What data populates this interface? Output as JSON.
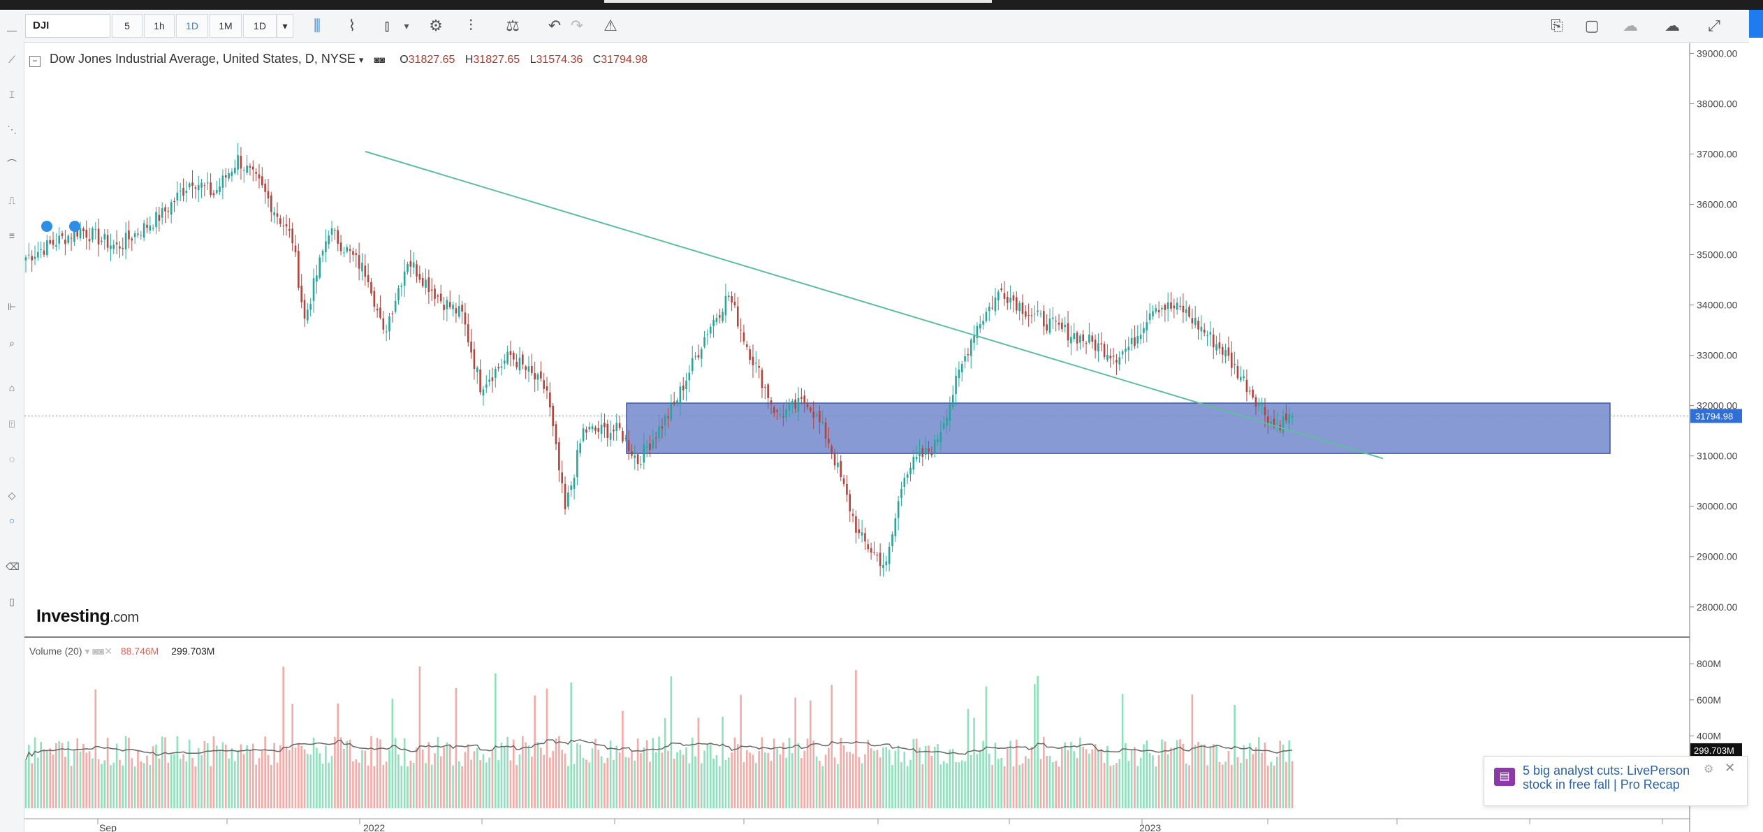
{
  "toolbar": {
    "symbol": "DJI",
    "intervals": [
      "5",
      "1h",
      "1D",
      "1M"
    ],
    "active_interval": "1D",
    "interval_dropdown": "1D"
  },
  "legend": {
    "title": "Dow Jones Industrial Average, United States, D, NYSE",
    "open_label": "O",
    "open": "31827.65",
    "high_label": "H",
    "high": "31827.65",
    "low_label": "L",
    "low": "31574.36",
    "close_label": "C",
    "close": "31794.98"
  },
  "volume_legend": {
    "title": "Volume (20)",
    "value1": "88.746M",
    "value2": "299.703M"
  },
  "logo": {
    "name": "Investing",
    "domain": ".com"
  },
  "news": {
    "text": "5 big analyst cuts: LivePerson stock in free fall | Pro Recap"
  },
  "colors": {
    "up": "#26a69a",
    "down": "#b2433d",
    "trendline": "#5fbf9a",
    "zone_fill": "#5a73c4",
    "vol_up": "#8fe0bd",
    "vol_down": "#f4aaa6",
    "price_tag": "#2f6fd6"
  },
  "chart_data": {
    "type": "candlestick",
    "series_name": "Dow Jones Industrial Average",
    "y_axis": {
      "ticks": [
        "39000.00",
        "38000.00",
        "37000.00",
        "36000.00",
        "35000.00",
        "34000.00",
        "33000.00",
        "32000.00",
        "31000.00",
        "30000.00",
        "29000.00",
        "28000.00"
      ],
      "ylim": [
        27400,
        39200
      ]
    },
    "x_axis": {
      "ticks": [
        "Sep",
        "2022",
        "2023"
      ]
    },
    "last_price_label": "31794.98",
    "zone": {
      "low": 31050,
      "high": 32050,
      "from": "2022-06",
      "to": "2023-05"
    },
    "trendline": {
      "from": [
        "2022-01",
        37050
      ],
      "to": [
        "2023-05",
        30950
      ]
    },
    "path": [
      [
        0,
        34950
      ],
      [
        18,
        35500
      ],
      [
        30,
        35150
      ],
      [
        45,
        35800
      ],
      [
        55,
        36500
      ],
      [
        62,
        36200
      ],
      [
        70,
        36900
      ],
      [
        77,
        36400
      ],
      [
        88,
        35300
      ],
      [
        92,
        33700
      ],
      [
        100,
        35500
      ],
      [
        113,
        34600
      ],
      [
        118,
        33400
      ],
      [
        126,
        34900
      ],
      [
        137,
        34100
      ],
      [
        144,
        33800
      ],
      [
        150,
        32400
      ],
      [
        160,
        33000
      ],
      [
        172,
        32300
      ],
      [
        178,
        29900
      ],
      [
        184,
        31500
      ],
      [
        196,
        31500
      ],
      [
        202,
        30900
      ],
      [
        214,
        32000
      ],
      [
        225,
        33500
      ],
      [
        232,
        34200
      ],
      [
        238,
        33200
      ],
      [
        248,
        31800
      ],
      [
        258,
        32100
      ],
      [
        265,
        31300
      ],
      [
        275,
        29400
      ],
      [
        284,
        28800
      ],
      [
        290,
        30700
      ],
      [
        300,
        31200
      ],
      [
        313,
        33500
      ],
      [
        322,
        34300
      ],
      [
        332,
        33800
      ],
      [
        342,
        33500
      ],
      [
        350,
        33300
      ],
      [
        360,
        33000
      ],
      [
        365,
        33200
      ],
      [
        372,
        34000
      ],
      [
        382,
        33900
      ],
      [
        395,
        33100
      ],
      [
        402,
        32500
      ],
      [
        412,
        31600
      ],
      [
        418,
        31800
      ]
    ],
    "volume_axis": {
      "ticks": [
        "800M",
        "600M",
        "400M"
      ],
      "ylim": [
        0,
        870
      ],
      "last_label": "299.703M"
    }
  }
}
